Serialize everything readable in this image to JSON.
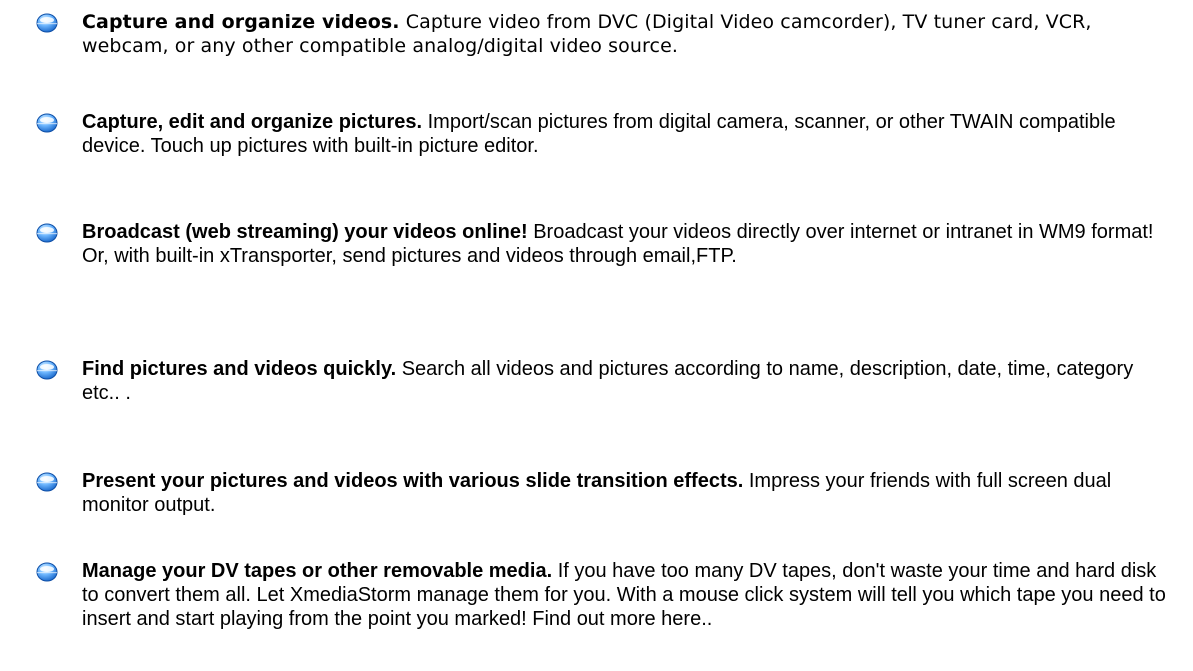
{
  "features": [
    {
      "title": "Capture and organize videos.",
      "body": " Capture video from DVC (Digital Video camcorder), TV tuner card, VCR, webcam, or any other compatible analog/digital video source.",
      "icon": "blue-bullet-icon"
    },
    {
      "title": "Capture, edit and organize pictures.",
      "body": " Import/scan pictures from digital camera, scanner, or other TWAIN compatible device. Touch up pictures with built-in picture editor.",
      "icon": "blue-bullet-icon"
    },
    {
      "title": "Broadcast (web streaming) your videos online!",
      "body": " Broadcast your videos directly over internet or intranet in WM9 format! Or, with built-in xTransporter, send pictures and videos through email,FTP.",
      "icon": "blue-bullet-icon"
    },
    {
      "title": "Find pictures and videos quickly.",
      "body": " Search all videos and pictures according to name, description, date, time, category etc.. .",
      "icon": "blue-bullet-icon"
    },
    {
      "title": "Present your pictures and videos with various slide transition effects.",
      "body": " Impress your friends with full screen dual monitor output.",
      "icon": "blue-bullet-icon"
    },
    {
      "title": "Manage your DV tapes or other removable media.",
      "body": " If you have too many DV tapes, don't waste your time and hard disk to convert them all. Let XmediaStorm manage them for you. With a mouse click system will tell you which tape you need to insert and start playing from the point you marked! Find out more here..",
      "icon": "blue-bullet-icon"
    }
  ],
  "colors": {
    "bullet_light": "#d8efff",
    "bullet_mid": "#6fb8ff",
    "bullet_dark": "#1463c8",
    "text": "#000000"
  }
}
